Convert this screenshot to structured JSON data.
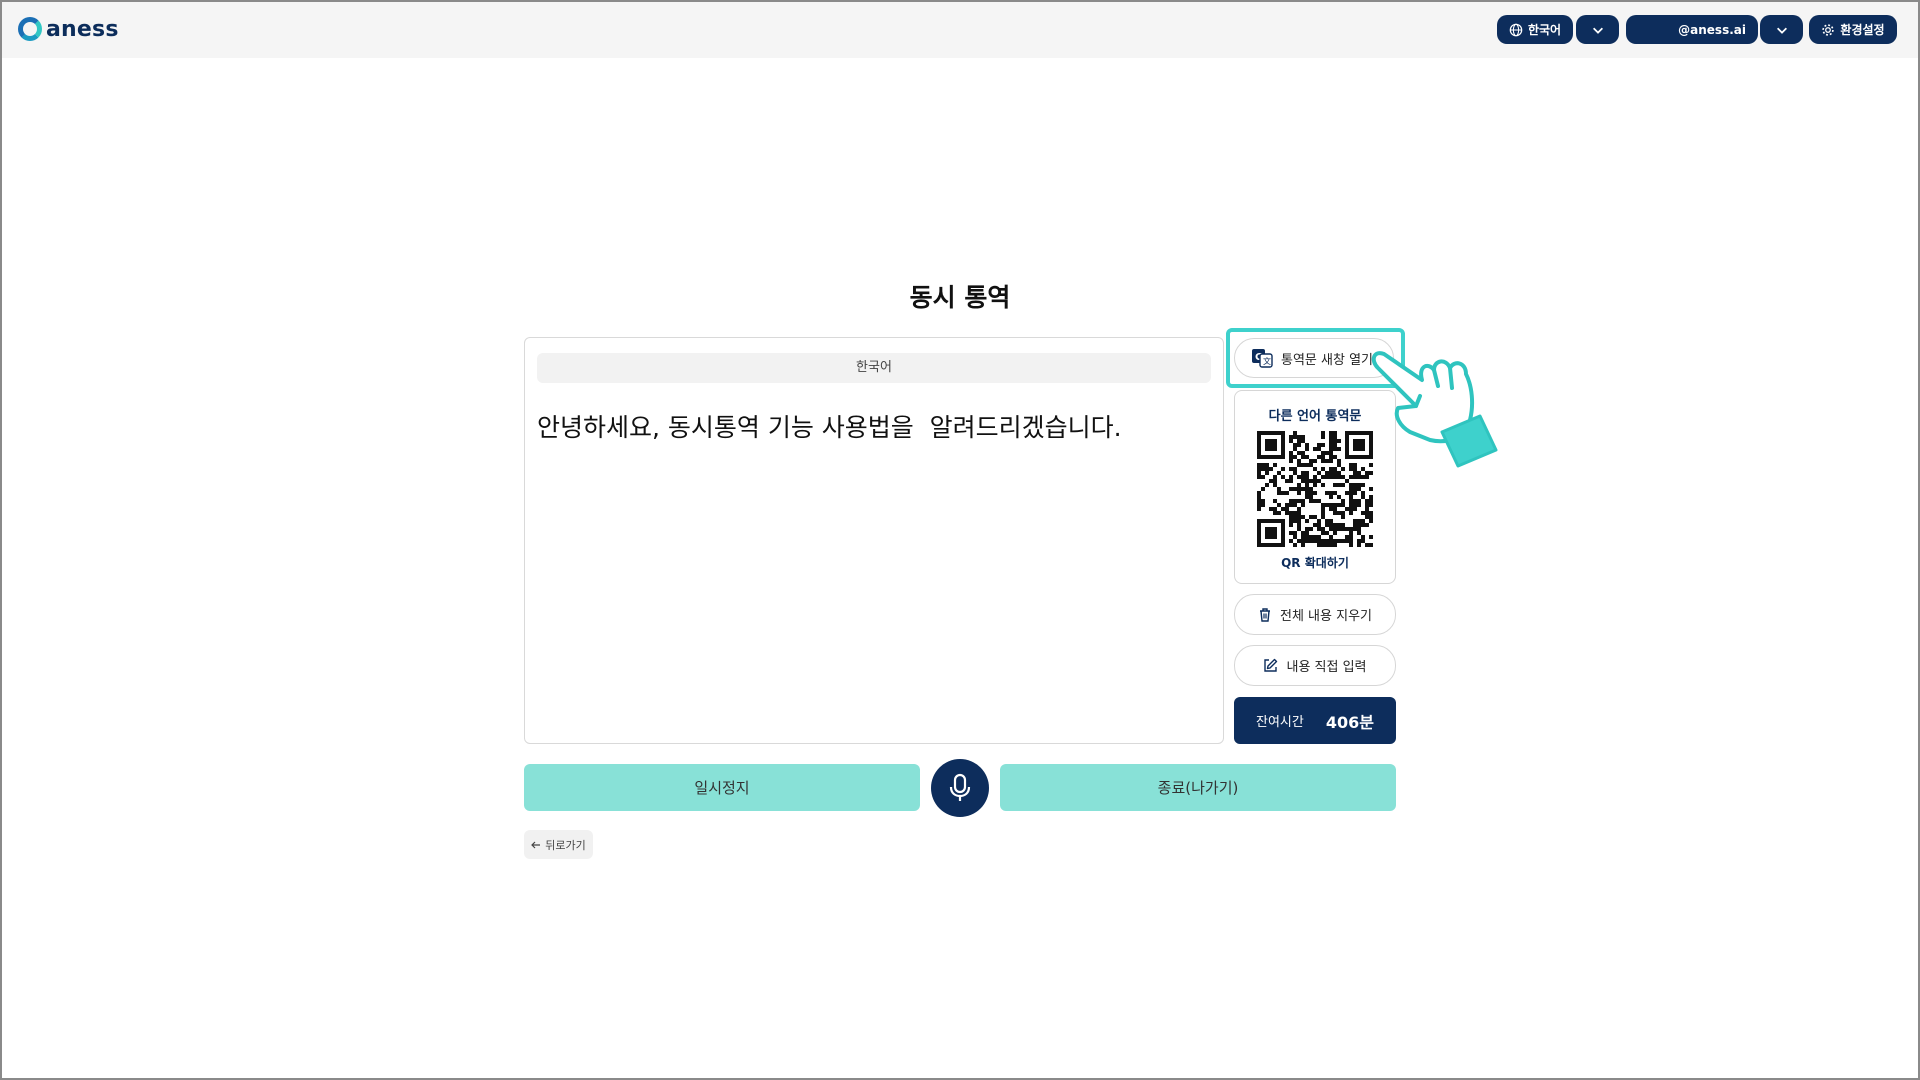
{
  "brand": {
    "name": "aness"
  },
  "header": {
    "language_label": "한국어",
    "account_label": "@aness.ai",
    "settings_label": "환경설정"
  },
  "main": {
    "title": "동시 통역",
    "source_language": "한국어",
    "transcript": "안녕하세요, 동시통역 기능 사용법을  알려드리겠습니다."
  },
  "side": {
    "open_window_label": "통역문 새창 열기",
    "qr_title": "다른 언어 통역문",
    "qr_zoom_label": "QR 확대하기",
    "clear_all_label": "전체 내용 지우기",
    "direct_input_label": "내용 직접 입력",
    "remaining_label": "잔여시간",
    "remaining_value": "406분"
  },
  "controls": {
    "pause_label": "일시정지",
    "end_label": "종료(나가기)",
    "back_label": "뒤로가기"
  },
  "colors": {
    "navy": "#0d2d5c",
    "mint": "#88e1d7",
    "highlight": "#3ed1cc"
  },
  "icons": [
    "globe-icon",
    "chevron-down-icon",
    "gear-icon",
    "translate-icon",
    "trash-icon",
    "edit-icon",
    "microphone-icon",
    "arrow-left-icon",
    "pointing-hand-icon",
    "qr-code"
  ]
}
